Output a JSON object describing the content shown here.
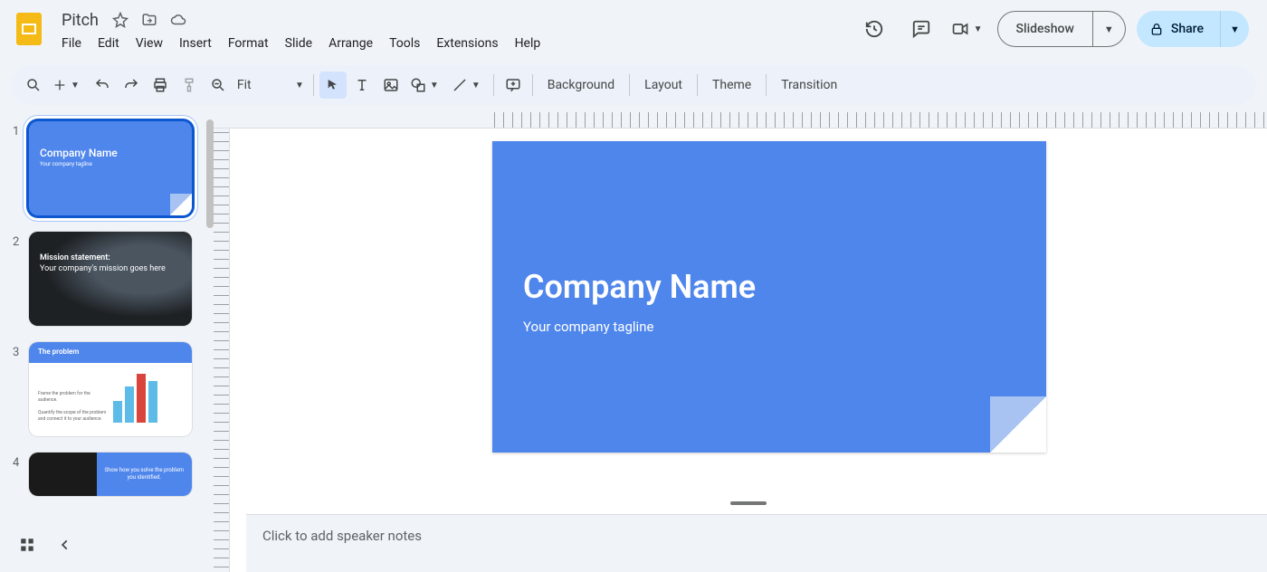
{
  "header": {
    "doc_title": "Pitch",
    "menu": [
      "File",
      "Edit",
      "View",
      "Insert",
      "Format",
      "Slide",
      "Arrange",
      "Tools",
      "Extensions",
      "Help"
    ],
    "slideshow_label": "Slideshow",
    "share_label": "Share"
  },
  "toolbar": {
    "zoom_label": "Fit",
    "background_label": "Background",
    "layout_label": "Layout",
    "theme_label": "Theme",
    "transition_label": "Transition"
  },
  "filmstrip": {
    "slides": [
      {
        "num": "1",
        "title": "Company Name",
        "sub": "Your company tagline"
      },
      {
        "num": "2",
        "title": "Mission statement:",
        "sub": "Your company's mission goes here"
      },
      {
        "num": "3",
        "title": "The problem",
        "line1": "Frame the problem for the audience.",
        "line2": "Quantify the scope of the problem and connect it to your audience."
      },
      {
        "num": "4",
        "text": "Show how you solve the problem you identified."
      }
    ]
  },
  "canvas": {
    "title": "Company Name",
    "subtitle": "Your company tagline"
  },
  "notes": {
    "placeholder": "Click to add speaker notes"
  }
}
